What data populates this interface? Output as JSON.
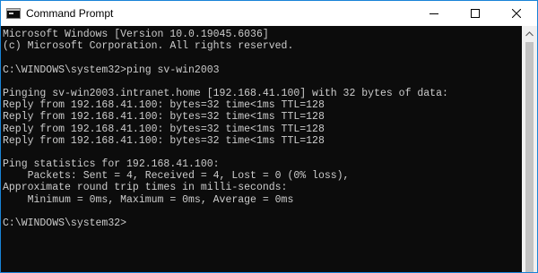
{
  "window": {
    "title": "Command Prompt"
  },
  "console": {
    "lines": [
      "Microsoft Windows [Version 10.0.19045.6036]",
      "(c) Microsoft Corporation. All rights reserved.",
      "",
      "C:\\WINDOWS\\system32>ping sv-win2003",
      "",
      "Pinging sv-win2003.intranet.home [192.168.41.100] with 32 bytes of data:",
      "Reply from 192.168.41.100: bytes=32 time<1ms TTL=128",
      "Reply from 192.168.41.100: bytes=32 time<1ms TTL=128",
      "Reply from 192.168.41.100: bytes=32 time<1ms TTL=128",
      "Reply from 192.168.41.100: bytes=32 time<1ms TTL=128",
      "",
      "Ping statistics for 192.168.41.100:",
      "    Packets: Sent = 4, Received = 4, Lost = 0 (0% loss),",
      "Approximate round trip times in milli-seconds:",
      "    Minimum = 0ms, Maximum = 0ms, Average = 0ms",
      "",
      "C:\\WINDOWS\\system32>"
    ]
  },
  "icons": {
    "app": "command-prompt-icon",
    "minimize": "minimize-icon",
    "maximize": "maximize-icon",
    "close": "close-icon",
    "scroll_up": "chevron-up-icon"
  },
  "colors": {
    "console_background": "#0c0c0c",
    "console_text": "#cccccc",
    "window_border": "#1883d7",
    "titlebar": "#ffffff"
  }
}
